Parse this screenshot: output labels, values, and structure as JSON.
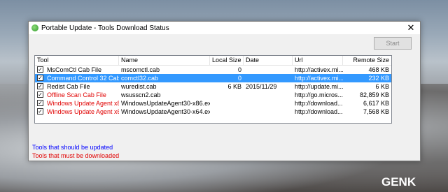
{
  "window": {
    "title": "Portable Update - Tools Download Status"
  },
  "toolbar": {
    "start_label": "Start"
  },
  "table": {
    "columns": [
      "Tool",
      "Name",
      "Local Size",
      "Date",
      "Url",
      "Remote Size"
    ],
    "rows": [
      {
        "tool": "MsComCtl Cab File",
        "name": "mscomctl.cab",
        "local_size": "0",
        "date": "",
        "url": "http://activex.mi...",
        "remote_size": "468 KB",
        "color": "#000000",
        "checked": true,
        "selected": false
      },
      {
        "tool": "Command Control 32 Cab File",
        "name": "comctl32.cab",
        "local_size": "0",
        "date": "",
        "url": "http://activex.mi...",
        "remote_size": "232 KB",
        "color": "#ffffff",
        "checked": true,
        "selected": true
      },
      {
        "tool": "Redist Cab File",
        "name": "wuredist.cab",
        "local_size": "6 KB",
        "date": "2015/11/29",
        "url": "http://update.mi...",
        "remote_size": "6 KB",
        "color": "#000000",
        "checked": true,
        "selected": false
      },
      {
        "tool": "Offline Scan Cab File",
        "name": "wsusscn2.cab",
        "local_size": "",
        "date": "",
        "url": "http://go.micros...",
        "remote_size": "82,859 KB",
        "color": "#e00000",
        "checked": true,
        "selected": false
      },
      {
        "tool": "Windows Update Agent x86",
        "name": "WindowsUpdateAgent30-x86.exe",
        "local_size": "",
        "date": "",
        "url": "http://download...",
        "remote_size": "6,617 KB",
        "color": "#e00000",
        "checked": true,
        "selected": false
      },
      {
        "tool": "Windows Update Agent x64",
        "name": "WindowsUpdateAgent30-x64.exe",
        "local_size": "",
        "date": "",
        "url": "http://download...",
        "remote_size": "7,568 KB",
        "color": "#e00000",
        "checked": true,
        "selected": false
      }
    ]
  },
  "legend": {
    "update_text": "Tools that should be updated",
    "update_color": "#0000ff",
    "download_text": "Tools that must be downloaded",
    "download_color": "#e00000"
  },
  "watermark": {
    "text": "GENK"
  }
}
